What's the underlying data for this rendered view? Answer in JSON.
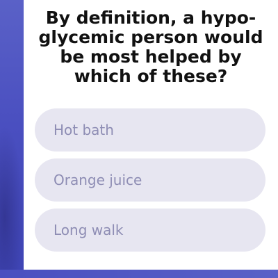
{
  "question": {
    "text": "By definition, a hypo-glycemic person would be most helped by which of these?"
  },
  "options": [
    {
      "label": "Hot bath"
    },
    {
      "label": "Orange juice"
    },
    {
      "label": "Long walk"
    }
  ],
  "colors": {
    "background_accent": "#4a4fc0",
    "card": "#ffffff",
    "option_fill": "#e7e6f1",
    "option_text": "#8e8db4",
    "question_text": "#111111"
  }
}
